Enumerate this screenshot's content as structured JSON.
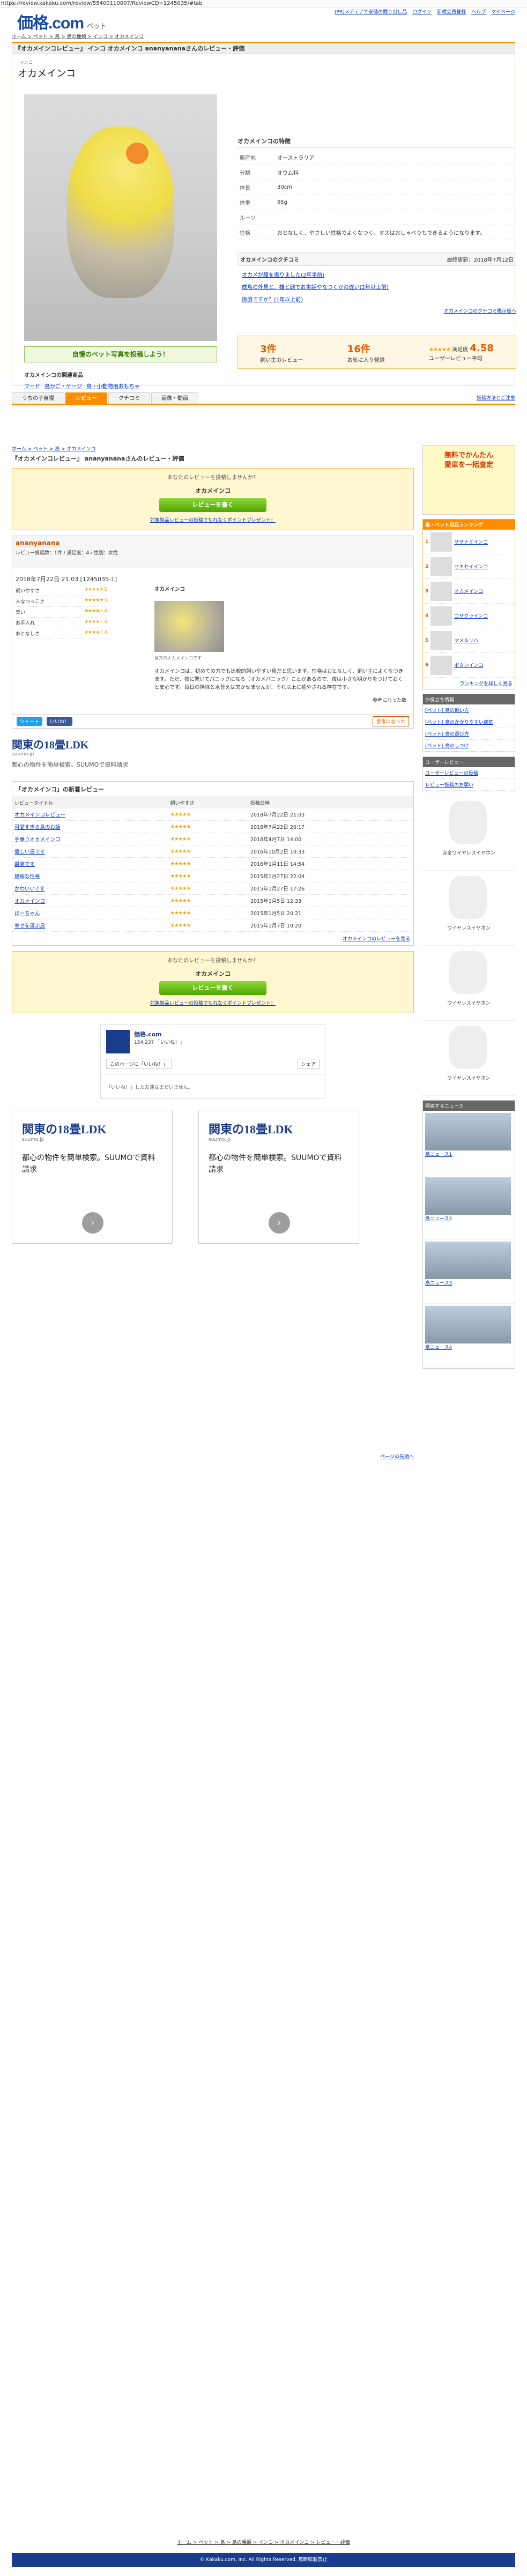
{
  "url": "https://review.kakaku.com/review/55400110007/ReviewCD=1245035/#tab",
  "header": {
    "logo": "価格.com",
    "pet": "ペット",
    "nav": [
      "(PR)メディアで安値の掘り出し品",
      "ログイン",
      "新規会員登録",
      "ヘルプ",
      "マイページ"
    ]
  },
  "breadcrumb": "ホーム > ペット > 鳥 > 鳥の種類 > インコ > オカメインコ",
  "title": "『オカメインコレビュー』 インコ オカメインコ ananyananaさんのレビュー・評価",
  "profile": {
    "ruby": "インコ",
    "name": "オカメインコ",
    "photo_button": "自慢のペット写真を投稿しよう！",
    "products": "オカメインコの関連商品",
    "product_links": [
      "フード",
      "鳥かご・ケージ",
      "鳥・小動物用おもちゃ"
    ]
  },
  "spec": {
    "heading": "オカメインコの特徴",
    "rows": [
      [
        "原産地",
        "オーストラリア"
      ],
      [
        "分類",
        "オウム科"
      ],
      [
        "体長",
        "30cm"
      ],
      [
        "体重",
        "95g"
      ],
      [
        "ルーツ",
        ""
      ],
      [
        "性格",
        "おとなしく、やさしい性格でよくなつく。オスはおしゃべりもできるようになります。"
      ]
    ]
  },
  "tips": {
    "heading": "オカメインコのクチコミ",
    "note": "最終更新：2018年7月12日",
    "items": [
      "オカメが腰を振りました(2年半前)",
      "成鳥の外見と、雄と雌でお世話やなつくかの違い(2年以上前)",
      "換羽ですか？(1年以上前)"
    ],
    "more": "オカメインコのクチコミ掲示板へ"
  },
  "ratings": {
    "reviews": "3件",
    "favorites": "16件",
    "score": "4.58",
    "labels": [
      "飼い主のレビュー",
      "お気に入り登録",
      "満足度",
      "ユーザーレビュー平均"
    ]
  },
  "tabs": [
    "うちの子自慢",
    "レビュー",
    "クチコミ",
    "画像・動画"
  ],
  "tabs_right": "投稿方法とご注意",
  "breadcrumb2": "ホーム > ペット > 鳥 > オカメインコ",
  "review_title": "『オカメインコレビュー』 ananyananaさんのレビュー・評価",
  "prompt": {
    "q": "あなたのレビューを投稿しませんか？",
    "name": "オカメインコ",
    "btn": "レビューを書く",
    "link": "対象製品レビューの投稿でもれなくポイントプレゼント！"
  },
  "review": {
    "user": "ananyanana",
    "date": "2018年7月22日 21:03 [1245035-1]",
    "user_meta": "レビュー投稿数：1件 / 満足度：4 / 性別：女性",
    "scores": [
      [
        "飼いやすさ",
        "5"
      ],
      [
        "人なつっこさ",
        "5"
      ],
      [
        "臭い",
        "4"
      ],
      [
        "お手入れ",
        "4"
      ],
      [
        "おとなしさ",
        "4"
      ]
    ],
    "name": "オカメインコ",
    "cap": "当方のオカメインコです",
    "body": "オカメインコは、初めての方でも比較的飼いやすい鳥だと思います。性格はおとなしく、飼い主によくなつきます。ただ、夜に驚いてパニックになる（オカメパニック）ことがあるので、夜は小さな明かりをつけておくと安心です。毎日の掃除と水替えは欠かせませんが、それ以上に癒やされる存在です。",
    "meta": "参考になった数",
    "tw": "ツイート",
    "fb": "いいね！",
    "ok": "参考になった"
  },
  "ad1": {
    "t": "関東の18畳LDK",
    "s": "suumo.jp",
    "d": "都心の物件を簡単検索。SUUMOで資料請求"
  },
  "list": {
    "heading": "「オカメインコ」の新着レビュー",
    "cols": [
      "レビュータイトル",
      "飼いやすさ",
      "投稿日時"
    ],
    "rows": [
      [
        "オカメインコレビュー",
        "2018年7月22日 21:03"
      ],
      [
        "可愛すぎる鳥のお話",
        "2018年7月22日 20:17"
      ],
      [
        "手乗りオカメインコ",
        "2018年4月7日 14:00"
      ],
      [
        "優しい鳥です",
        "2016年10月2日 10:33"
      ],
      [
        "最高です",
        "2016年1月11日 14:54"
      ],
      [
        "臆病な性格",
        "2015年1月27日 22:04"
      ],
      [
        "かわいいです",
        "2015年1月27日 17:26"
      ],
      [
        "オカメインコ",
        "2015年1月5日 12:33"
      ],
      [
        "ほーちゃん",
        "2015年1月5日 20:21"
      ],
      [
        "幸せを運ぶ鳥",
        "2015年1月7日 10:20"
      ]
    ],
    "more": "オカメインコのレビューを見る"
  },
  "share": {
    "site": "価格.com",
    "count": "154,237 「いいね！」",
    "text": "「いいね！」した友達はまだいません。",
    "btn": "このページに「いいね！」",
    "share": "シェア"
  },
  "ad2": {
    "t": "関東の18畳LDK",
    "s": "suumo.jp",
    "d": "都心の物件を簡単検索。SUUMOで資料請求"
  },
  "pagetop": "ページの先頭へ",
  "side": {
    "ad": [
      "無料でかんたん",
      "愛車を一括査定"
    ],
    "rank_h": "鳥・ペット用品ランキング",
    "ranks": [
      "サザナミインコ",
      "セキセイインコ",
      "オカメインコ",
      "コザクラインコ",
      "マメルリハ",
      "ボタンインコ"
    ],
    "more1": "ランキングを詳しく見る",
    "link_h": "お役立ち情報",
    "links": [
      "[ペット] 鳥の飼い方",
      "[ペット] 鳥のかかりやすい病気",
      "[ペット] 鳥の選び方",
      "[ペット] 鳥のしつけ"
    ],
    "sp_h": "ユーザーレビュー",
    "sps": [
      "ユーザーレビューの投稿",
      "レビュー投稿のお願い"
    ],
    "prods": [
      "完全ワイヤレスイヤホン",
      "ワイヤレスイヤホン",
      "ワイヤレスイヤホン",
      "ワイヤレスイヤホン"
    ],
    "news_h": "関連するニュース",
    "news": [
      "鳥ニュース1",
      "鳥ニュース2",
      "鳥ニュース3",
      "鳥ニュース4"
    ]
  },
  "footer": "ホーム > ペット > 鳥 > 鳥の種類 > インコ > オカメインコ > レビュー・評価",
  "copyright": "© Kakaku.com, Inc. All Rights Reserved. 無断転載禁止"
}
